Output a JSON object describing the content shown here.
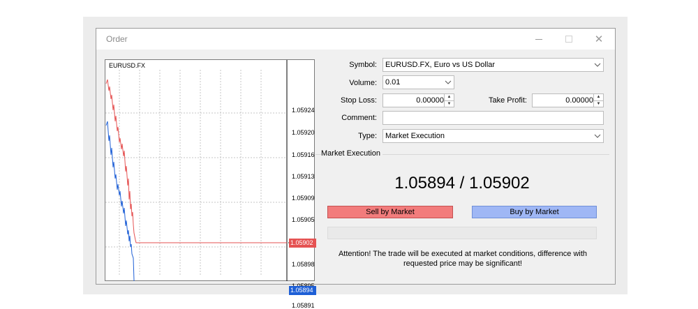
{
  "window": {
    "title": "Order"
  },
  "chart": {
    "symbol": "EURUSD.FX",
    "price_labels": [
      "1.05924",
      "1.05920",
      "1.05916",
      "1.05913",
      "1.05909",
      "1.05905",
      "1.05898",
      "1.05895",
      "1.05891"
    ],
    "ask_tag": "1.05902",
    "bid_tag": "1.05894",
    "ask_color": "#e55252",
    "bid_color": "#1e5fd6"
  },
  "form": {
    "symbol_label": "Symbol:",
    "symbol_value": "EURUSD.FX, Euro vs US Dollar",
    "volume_label": "Volume:",
    "volume_value": "0.01",
    "stop_loss_label": "Stop Loss:",
    "stop_loss_value": "0.00000",
    "take_profit_label": "Take Profit:",
    "take_profit_value": "0.00000",
    "comment_label": "Comment:",
    "comment_value": "",
    "type_label": "Type:",
    "type_value": "Market Execution"
  },
  "execution": {
    "group_title": "Market Execution",
    "quote": "1.05894 / 1.05902",
    "sell_label": "Sell by Market",
    "buy_label": "Buy by Market",
    "sell_color": "#f27c7c",
    "buy_color": "#9fb7f5",
    "notice_line1": "Attention! The trade will be executed at market conditions, difference with",
    "notice_line2": "requested price may be significant!"
  }
}
